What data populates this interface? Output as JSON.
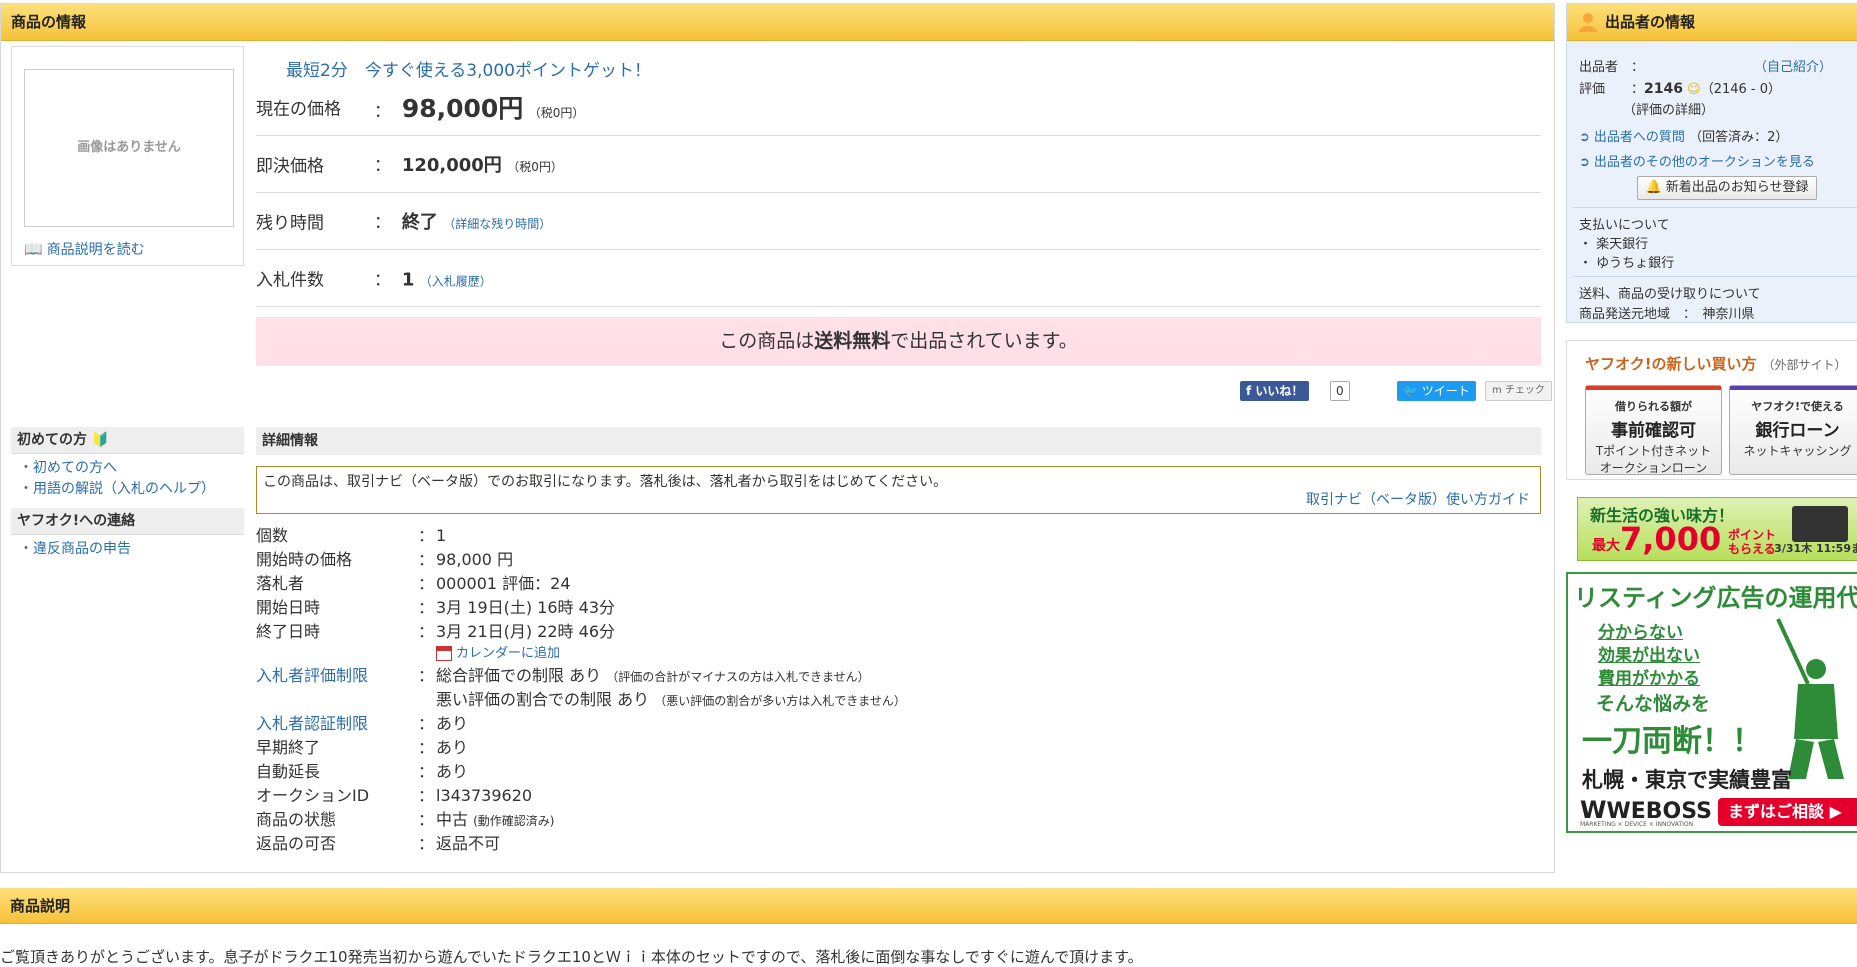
{
  "product": {
    "header": "商品の情報",
    "no_image": "画像はありません",
    "read_description": "商品説明を読む",
    "promo": "最短2分　今すぐ使える3,000ポイントゲット！",
    "rows": [
      {
        "label": "現在の価格",
        "colon": "：",
        "value": "98,000円",
        "note": "（税0円）"
      },
      {
        "label": "即決価格",
        "colon": "：",
        "value": "120,000円",
        "note": "（税0円）"
      },
      {
        "label": "残り時間",
        "colon": "：",
        "value": "終了",
        "note": "（詳細な残り時間）"
      },
      {
        "label": "入札件数",
        "colon": "：",
        "value": "1",
        "note": "（入札履歴）"
      }
    ],
    "free_shipping": {
      "pre": "この商品は",
      "bold": "送料無料",
      "post": "で出品されています。"
    },
    "social": {
      "like": "いいね！",
      "like_count": "0",
      "tweet": "ツイート",
      "check": "チェック"
    }
  },
  "leftnav": {
    "section1": {
      "title": "初めての方",
      "items": [
        "初めての方へ",
        "用語の解説（入札のヘルプ）"
      ]
    },
    "section2": {
      "title": "ヤフオク!への連絡",
      "items": [
        "違反商品の申告"
      ]
    }
  },
  "details": {
    "header": "詳細情報",
    "navi_text": "この商品は、取引ナビ（ベータ版）でのお取引になります。落札後は、落札者から取引をはじめてください。",
    "navi_guide": "取引ナビ（ベータ版）使い方ガイド",
    "rows": [
      {
        "k": "個数",
        "v": "1"
      },
      {
        "k": "開始時の価格",
        "v": "98,000 円"
      },
      {
        "k": "落札者",
        "v": "000001 評価：24"
      },
      {
        "k": "開始日時",
        "v": "3月 19日(土) 16時 43分"
      },
      {
        "k": "終了日時",
        "v": "3月 21日(月) 22時 46分"
      },
      {
        "k": "",
        "v": "カレンダーに追加"
      },
      {
        "k": "入札者評価制限",
        "v": "総合評価での制限 あり",
        "note": "（評価の合計がマイナスの方は入札できません）"
      },
      {
        "k": "",
        "v": "悪い評価の割合での制限 あり",
        "note": "（悪い評価の割合が多い方は入札できません）"
      },
      {
        "k": "入札者認証制限",
        "v": "あり"
      },
      {
        "k": "早期終了",
        "v": "あり"
      },
      {
        "k": "自動延長",
        "v": "あり"
      },
      {
        "k": "オークションID",
        "v": "l343739620"
      },
      {
        "k": "商品の状態",
        "v": "中古",
        "note": "(動作確認済み)"
      },
      {
        "k": "返品の可否",
        "v": "返品不可"
      }
    ]
  },
  "description": {
    "header": "商品説明",
    "text": "ご覧頂きありがとうございます。息子がドラクエ10発売当初から遊んでいたドラクエ10とＷｉｉ本体のセットですので、落札後に面倒な事なしですぐに遊んで頂けます。"
  },
  "seller": {
    "header": "出品者の情報",
    "seller_label": "出品者　：",
    "self_intro": "（自己紹介）",
    "rating_label": "評価　　：",
    "rating_value": "2146",
    "rating_breakdown": "（2146 - 0）",
    "rating_detail": "（評価の詳細）",
    "question": "出品者への質問",
    "answered": "（回答済み：2）",
    "other_auctions": "出品者のその他のオークションを見る",
    "notify": "新着出品のお知らせ登録",
    "payment_title": "支払いについて",
    "payment_items": [
      "楽天銀行",
      "ゆうちょ銀行"
    ],
    "shipping_title": "送料、商品の受け取りについて",
    "origin": "商品発送元地域　：　神奈川県"
  },
  "newway": {
    "title": "ヤフオク!の新しい買い方",
    "external": "（外部サイト）",
    "card1": {
      "l1": "借りられる額が",
      "l2": "事前確認可",
      "l3a": "Tポイント付きネット",
      "l3b": "オークションローン"
    },
    "card2": {
      "l1": "ヤフオク!で使える",
      "l2": "銀行ローン",
      "l3a": "ネットキャッシング",
      "l3b": ""
    }
  },
  "ad1": {
    "l1": "新生活の強い味方！",
    "l2": "7,000",
    "l2pre": "最大",
    "l3a": "ポイント",
    "l3b": "もらえる",
    "l4": "3/31木 11:59ま"
  },
  "ad2": {
    "headline": "リスティング広告の運用代行",
    "worries": [
      "分からない",
      "効果が出ない",
      "費用がかかる"
    ],
    "worry_tail": "そんな悩みを",
    "big": "一刀両断！！",
    "city": "札幌・東京で実績豊富",
    "logo": "WEBOSS",
    "logo_sub": "MARKETING × DEVICE × INNOVATION",
    "cta": "まずはご相談"
  },
  "colors": {
    "yellow_bar": "#f6c23a",
    "link": "#2b6ea8",
    "pink": "#ffe0e6",
    "seller_bg": "#eaf1fa"
  }
}
